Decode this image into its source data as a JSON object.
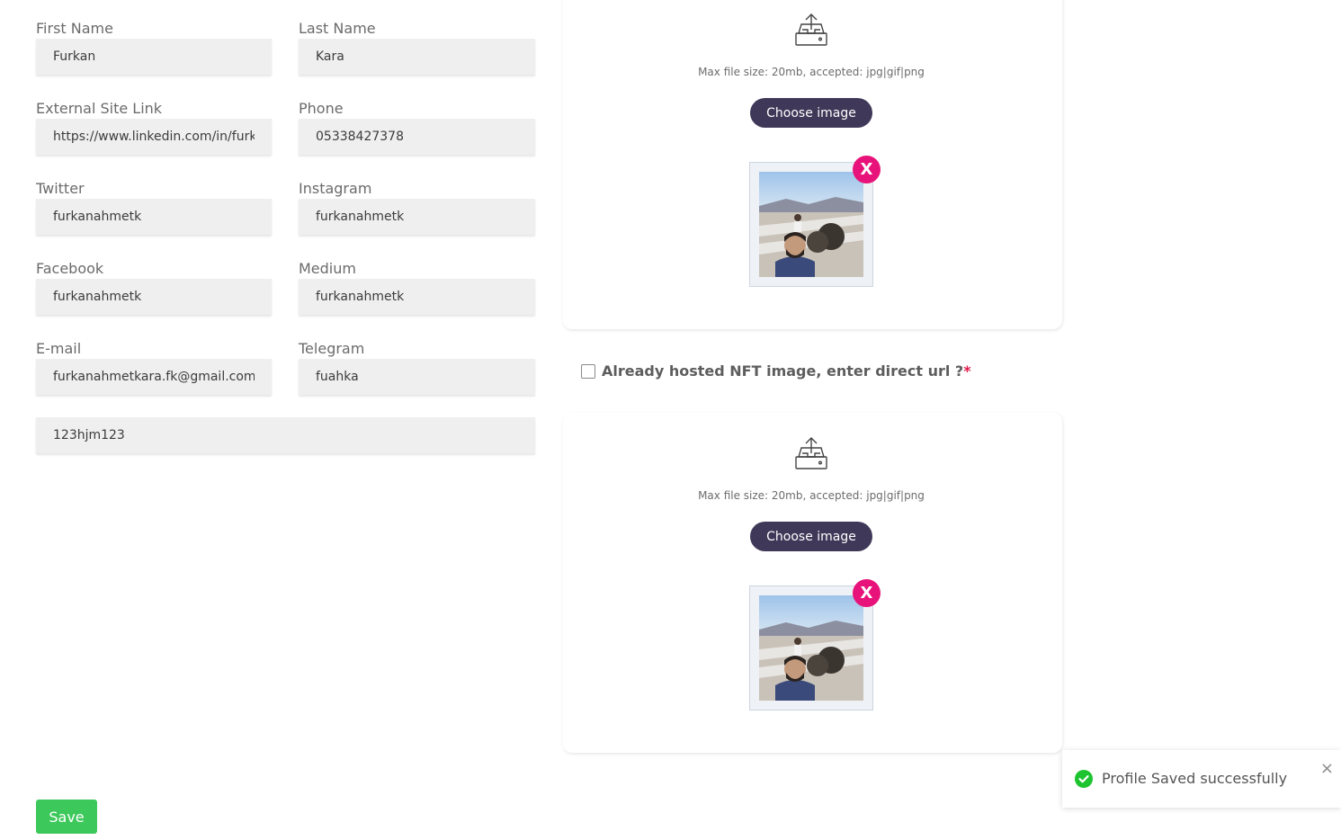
{
  "form": {
    "first_name": {
      "label": "First Name",
      "value": "Furkan"
    },
    "last_name": {
      "label": "Last Name",
      "value": "Kara"
    },
    "external_link": {
      "label": "External Site Link",
      "value": "https://www.linkedin.com/in/furka"
    },
    "phone": {
      "label": "Phone",
      "value": "05338427378"
    },
    "twitter": {
      "label": "Twitter",
      "value": "furkanahmetk"
    },
    "instagram": {
      "label": "Instagram",
      "value": "furkanahmetk"
    },
    "facebook": {
      "label": "Facebook",
      "value": "furkanahmetk"
    },
    "medium": {
      "label": "Medium",
      "value": "furkanahmetk"
    },
    "email": {
      "label": "E-mail",
      "value": "furkanahmetkara.fk@gmail.com"
    },
    "telegram": {
      "label": "Telegram",
      "value": "fuahka"
    },
    "extra": {
      "value": "123hjm123"
    },
    "save_label": "Save"
  },
  "upload_top": {
    "note": "Max file size: 20mb, accepted: jpg|gif|png",
    "choose_label": "Choose image",
    "remove_label": "X"
  },
  "hosted": {
    "label": "Already hosted NFT image, enter direct url ?",
    "required": "*",
    "checked": false
  },
  "upload_bottom": {
    "note": "Max file size: 20mb, accepted: jpg|gif|png",
    "choose_label": "Choose image",
    "remove_label": "X"
  },
  "toast": {
    "message": "Profile Saved successfully",
    "close": "×"
  },
  "colors": {
    "primary_button": "#3f3858",
    "save_button": "#3cc85a",
    "remove_badge": "#e8137a",
    "success": "#1ec42f"
  }
}
